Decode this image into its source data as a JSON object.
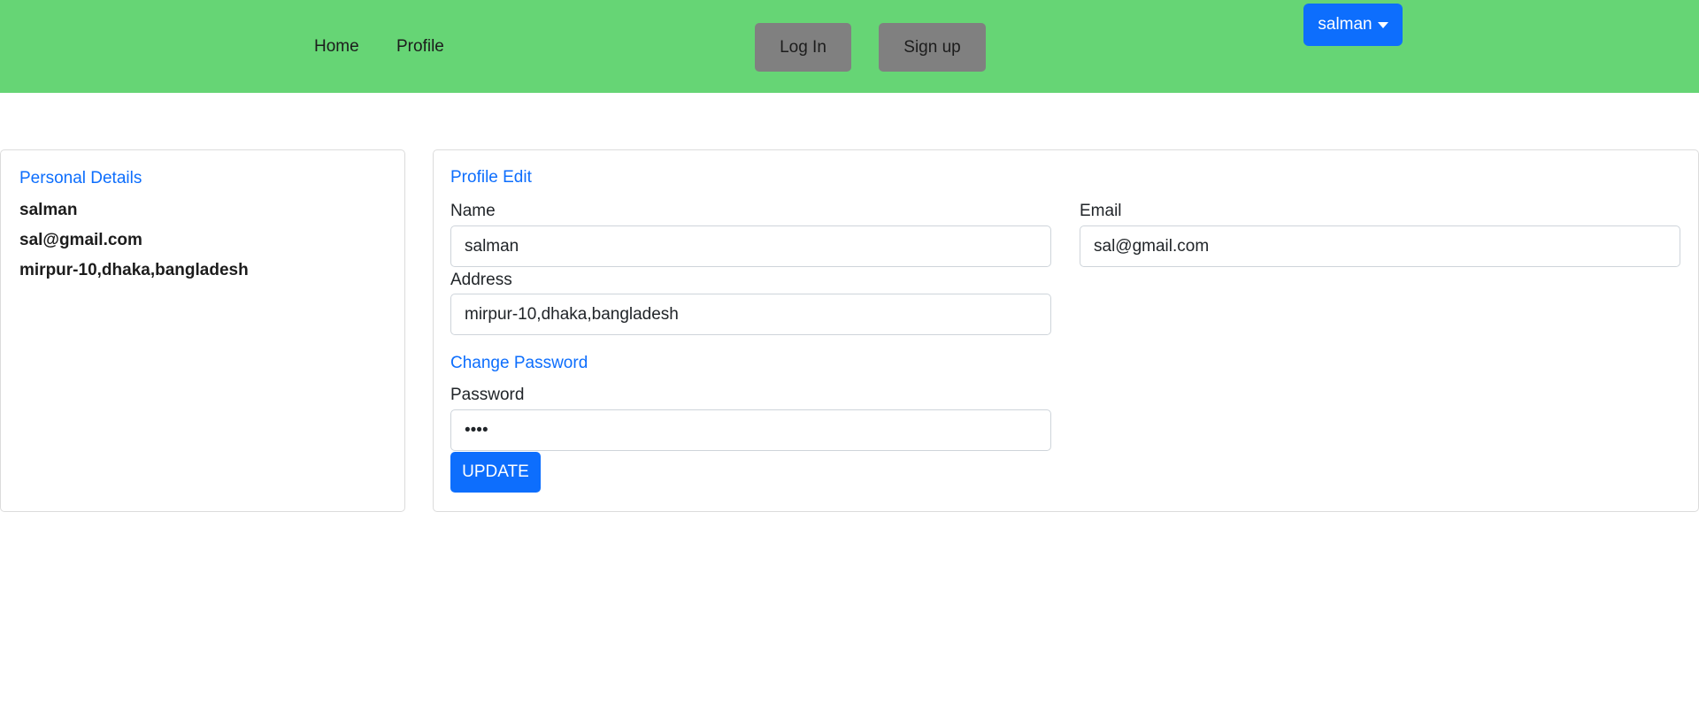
{
  "nav": {
    "home": "Home",
    "profile": "Profile",
    "login": "Log In",
    "signup": "Sign up",
    "user": "salman"
  },
  "personal": {
    "title": "Personal Details",
    "name": "salman",
    "email": "sal@gmail.com",
    "address": "mirpur-10,dhaka,bangladesh"
  },
  "form": {
    "title": "Profile Edit",
    "name_label": "Name",
    "name_value": "salman",
    "email_label": "Email",
    "email_value": "sal@gmail.com",
    "address_label": "Address",
    "address_value": "mirpur-10,dhaka,bangladesh",
    "password_section": "Change Password",
    "password_label": "Password",
    "password_value": "••••",
    "update": "UPDATE"
  }
}
